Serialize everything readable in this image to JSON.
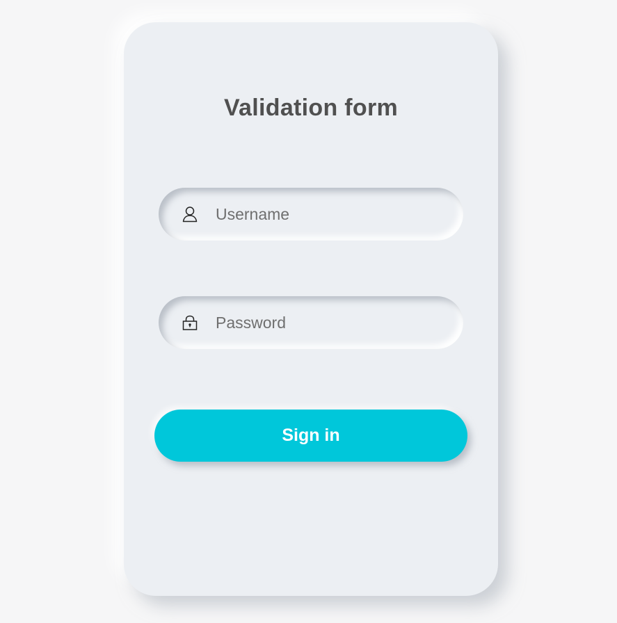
{
  "form": {
    "title": "Validation form",
    "username": {
      "placeholder": "Username",
      "value": "",
      "icon": "user-icon"
    },
    "password": {
      "placeholder": "Password",
      "value": "",
      "icon": "lock-icon"
    },
    "submit_label": "Sign in"
  },
  "colors": {
    "page_background": "#f6f6f7",
    "card_background": "#eceff3",
    "accent": "#00c7da",
    "title_text": "#505050",
    "placeholder_text": "#6f6f6f"
  }
}
